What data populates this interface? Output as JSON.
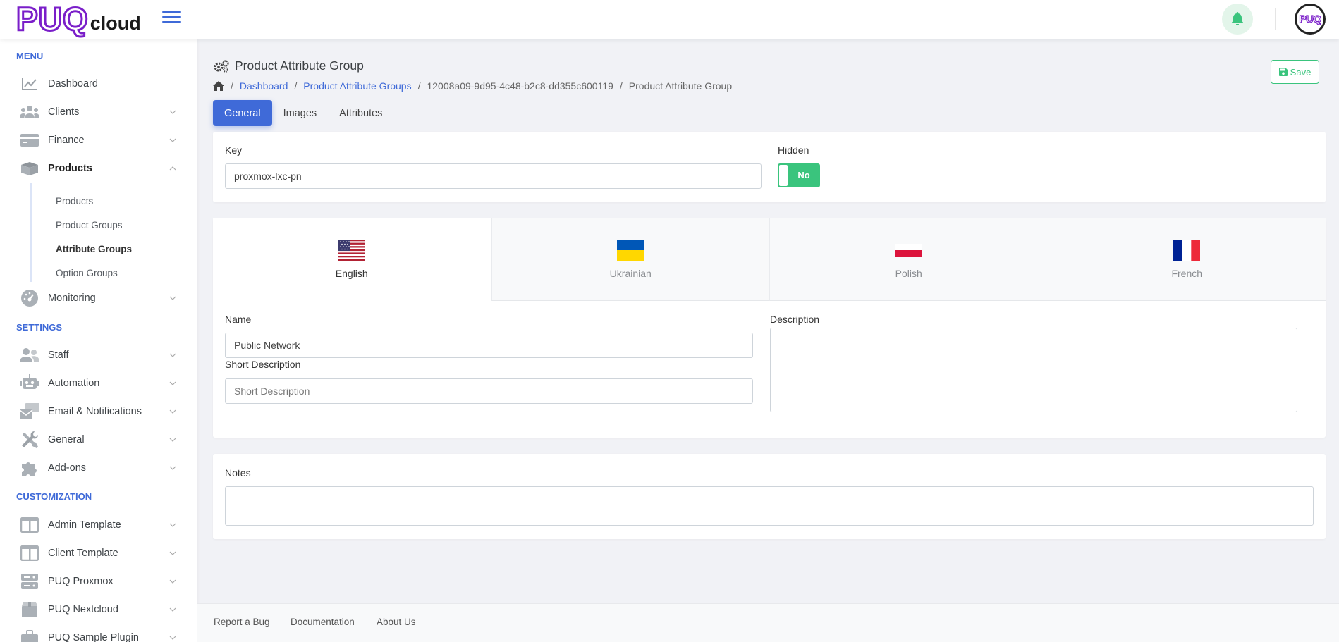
{
  "brand": {
    "logo_main": "PUQ",
    "logo_sub": "cloud",
    "avatar_text": "PUQ"
  },
  "sidebar": {
    "menu_heading": "MENU",
    "settings_heading": "SETTINGS",
    "customization_heading": "CUSTOMIZATION",
    "menu_items": [
      {
        "label": "Dashboard",
        "icon": "chart-line-icon"
      },
      {
        "label": "Clients",
        "icon": "users-icon"
      },
      {
        "label": "Finance",
        "icon": "credit-card-icon"
      },
      {
        "label": "Products",
        "icon": "boxes-icon"
      },
      {
        "label": "Monitoring",
        "icon": "tachometer-icon"
      }
    ],
    "product_sub_items": [
      "Products",
      "Product Groups",
      "Attribute Groups",
      "Option Groups"
    ],
    "settings_items": [
      {
        "label": "Staff",
        "icon": "staff-icon"
      },
      {
        "label": "Automation",
        "icon": "robot-icon"
      },
      {
        "label": "Email & Notifications",
        "icon": "mail-bulk-icon"
      },
      {
        "label": "General",
        "icon": "tools-icon"
      },
      {
        "label": "Add-ons",
        "icon": "puzzle-icon"
      }
    ],
    "customization_items": [
      {
        "label": "Admin Template",
        "icon": "columns-icon"
      },
      {
        "label": "Client Template",
        "icon": "columns-icon"
      },
      {
        "label": "PUQ Proxmox",
        "icon": "server-icon"
      },
      {
        "label": "PUQ Nextcloud",
        "icon": "box-icon"
      },
      {
        "label": "PUQ Sample Plugin",
        "icon": "briefcase-icon"
      }
    ]
  },
  "page": {
    "title": "Product Attribute Group",
    "save_label": "Save",
    "breadcrumb": [
      "Dashboard",
      "Product Attribute Groups",
      "12008a09-9d95-4c48-b2c8-dd355c600119",
      "Product Attribute Group"
    ],
    "tabs": [
      "General",
      "Images",
      "Attributes"
    ]
  },
  "general": {
    "key_label": "Key",
    "key_value": "proxmox-lxc-pn",
    "hidden_label": "Hidden",
    "hidden_value": "No"
  },
  "languages": [
    {
      "name": "English",
      "flag": "us-flag-icon"
    },
    {
      "name": "Ukrainian",
      "flag": "ua-flag-icon"
    },
    {
      "name": "Polish",
      "flag": "pl-flag-icon"
    },
    {
      "name": "French",
      "flag": "fr-flag-icon"
    }
  ],
  "translation": {
    "name_label": "Name",
    "name_value": "Public Network",
    "short_description_label": "Short Description",
    "short_description_placeholder": "Short Description",
    "description_label": "Description"
  },
  "notes": {
    "label": "Notes"
  },
  "footer": {
    "links": [
      "Report a Bug",
      "Documentation",
      "About Us"
    ]
  },
  "colors": {
    "primary": "#3f6ad8",
    "success": "#3ac47d",
    "brand": "#7a1ec9"
  }
}
